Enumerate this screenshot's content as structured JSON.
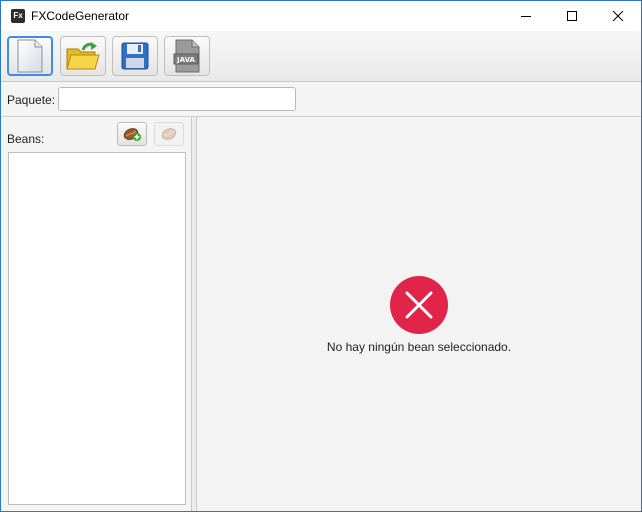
{
  "window": {
    "title": "FXCodeGenerator",
    "app_icon_text": "Fx"
  },
  "toolbar": {
    "buttons": [
      {
        "icon": "new-file-icon"
      },
      {
        "icon": "open-folder-icon"
      },
      {
        "icon": "save-disk-icon"
      },
      {
        "icon": "java-file-icon",
        "icon_text": "JAVA"
      }
    ]
  },
  "package": {
    "label": "Paquete:",
    "value": ""
  },
  "beans": {
    "label": "Beans:",
    "add_icon": "add-bean-icon",
    "remove_icon": "remove-bean-icon",
    "items": []
  },
  "detail": {
    "empty_message": "No hay ningún bean seleccionado.",
    "icon": "error-x-icon",
    "icon_color": "#e0244a"
  },
  "colors": {
    "accent": "#3c8fe0",
    "window_border": "#2b79c2"
  }
}
